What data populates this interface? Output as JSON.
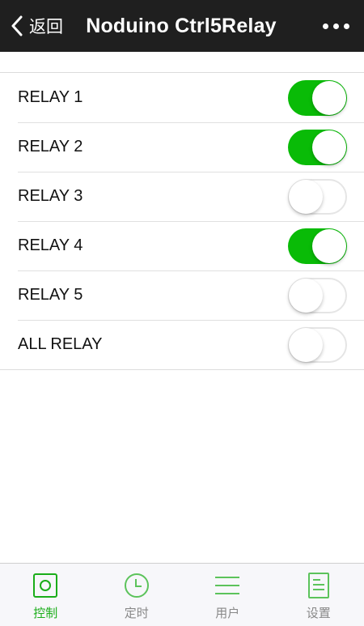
{
  "navbar": {
    "back_label": "返回",
    "title": "Noduino Ctrl5Relay"
  },
  "relays": [
    {
      "label": "RELAY 1",
      "on": true
    },
    {
      "label": "RELAY 2",
      "on": true
    },
    {
      "label": "RELAY 3",
      "on": false
    },
    {
      "label": "RELAY 4",
      "on": true
    },
    {
      "label": "RELAY 5",
      "on": false
    },
    {
      "label": "ALL RELAY",
      "on": false
    }
  ],
  "tabs": [
    {
      "label": "控制",
      "icon": "control-icon",
      "active": true
    },
    {
      "label": "定时",
      "icon": "clock-icon",
      "active": false
    },
    {
      "label": "用户",
      "icon": "menu-lines-icon",
      "active": false
    },
    {
      "label": "设置",
      "icon": "settings-doc-icon",
      "active": false
    }
  ],
  "colors": {
    "navbar_bg": "#1f1f1f",
    "switch_on": "#09bb07",
    "tab_active": "#1aad19",
    "tab_inactive_icon": "#5cc35b"
  }
}
